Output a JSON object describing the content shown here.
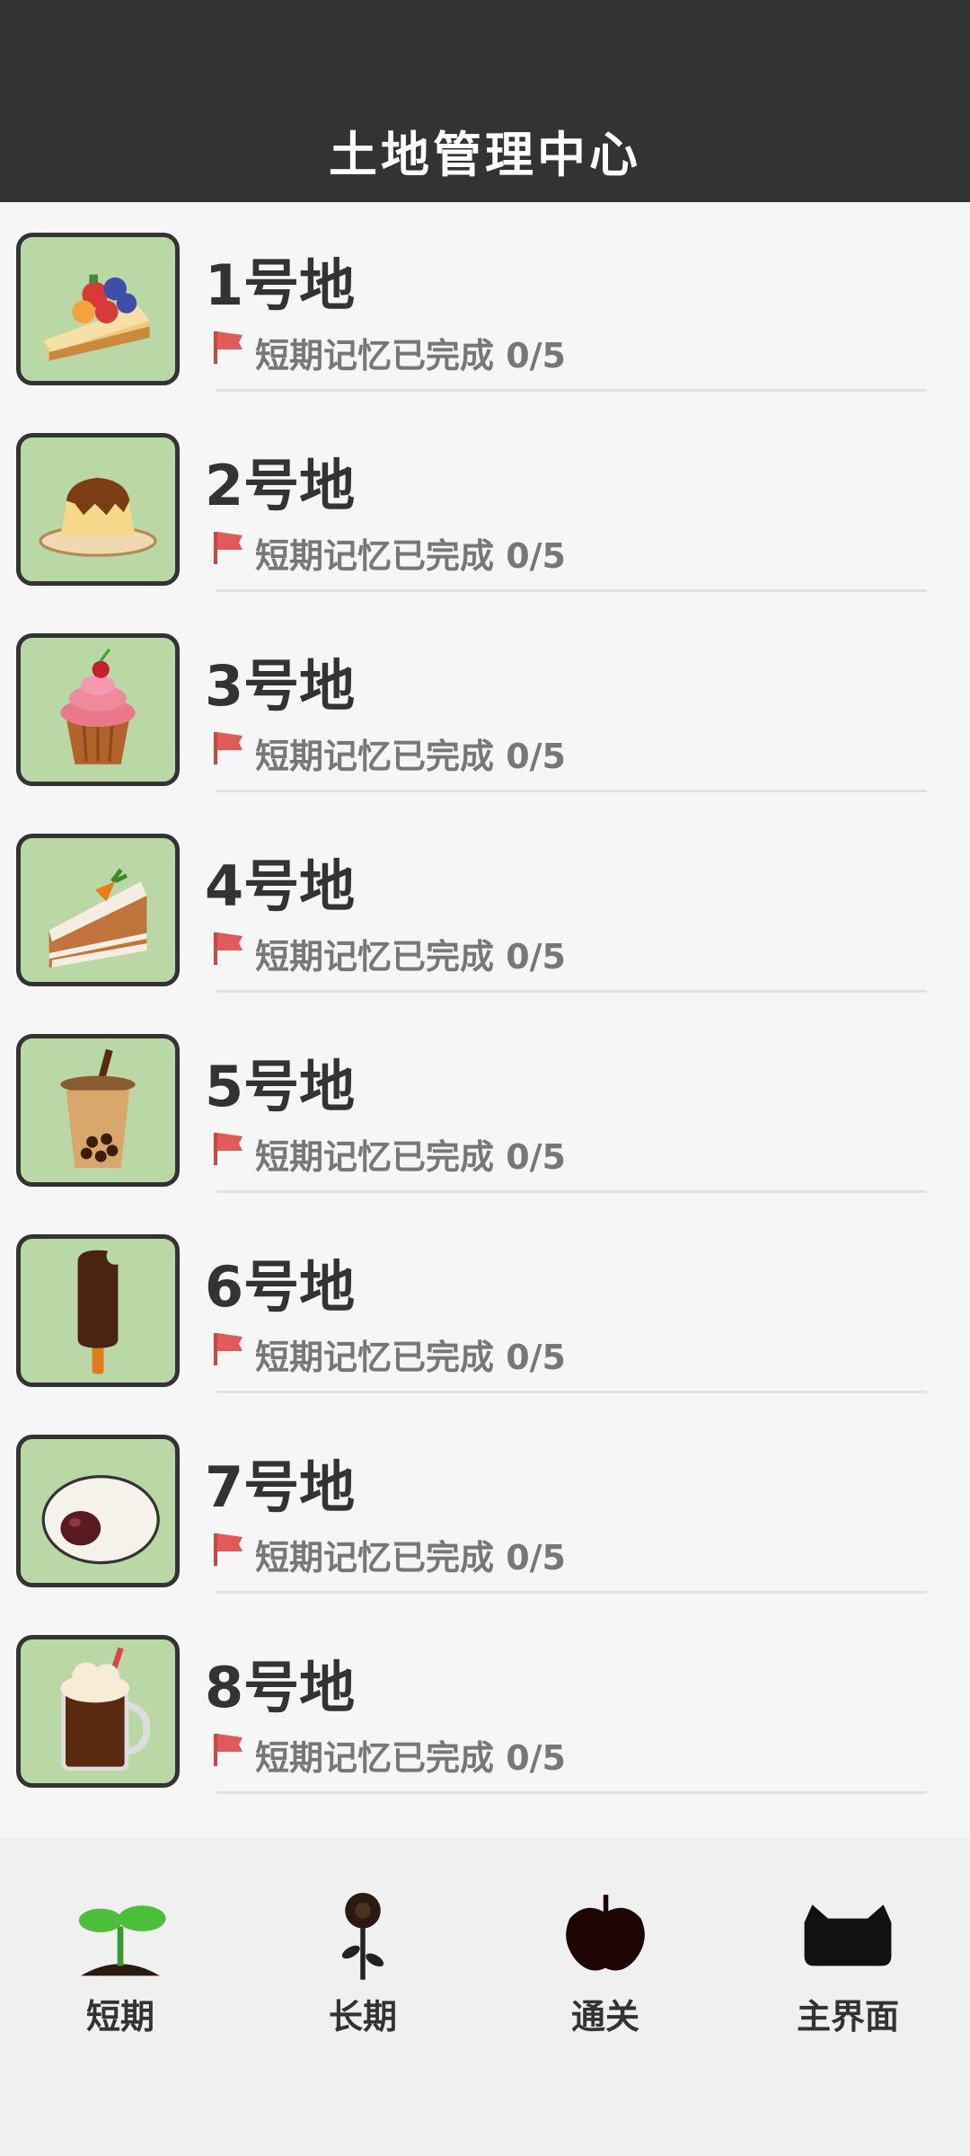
{
  "header": {
    "title": "土地管理中心"
  },
  "plots": [
    {
      "name": "1号地",
      "status": "短期记忆已完成 0/5",
      "icon": "fruit-tart-icon"
    },
    {
      "name": "2号地",
      "status": "短期记忆已完成 0/5",
      "icon": "pudding-icon"
    },
    {
      "name": "3号地",
      "status": "短期记忆已完成 0/5",
      "icon": "cupcake-icon"
    },
    {
      "name": "4号地",
      "status": "短期记忆已完成 0/5",
      "icon": "carrot-cake-icon"
    },
    {
      "name": "5号地",
      "status": "短期记忆已完成 0/5",
      "icon": "bubble-tea-icon"
    },
    {
      "name": "6号地",
      "status": "短期记忆已完成 0/5",
      "icon": "ice-cream-bar-icon"
    },
    {
      "name": "7号地",
      "status": "短期记忆已完成 0/5",
      "icon": "daifuku-icon"
    },
    {
      "name": "8号地",
      "status": "短期记忆已完成 0/5",
      "icon": "root-beer-float-icon"
    }
  ],
  "tabs": [
    {
      "label": "短期",
      "icon": "sprout-icon"
    },
    {
      "label": "长期",
      "icon": "flower-icon"
    },
    {
      "label": "通关",
      "icon": "apple-icon"
    },
    {
      "label": "主界面",
      "icon": "cat-icon"
    }
  ],
  "colors": {
    "header_bg": "#333333",
    "thumb_bg": "#b9d8a6",
    "flag": "#e05a5a",
    "page_bg": "#f6f6f6"
  }
}
